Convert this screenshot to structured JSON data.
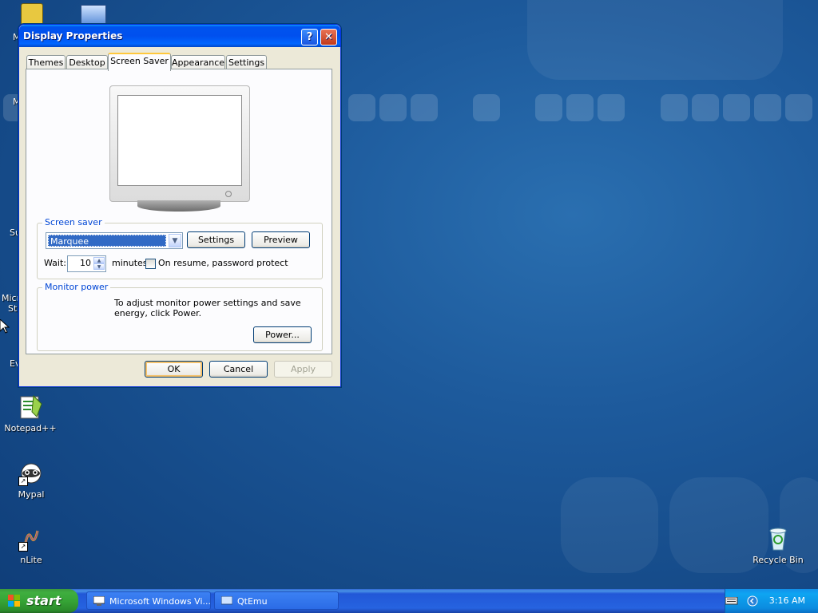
{
  "desktop": {
    "icons": [
      {
        "label": "Notepad++",
        "icon": "notepadpp-icon"
      },
      {
        "label": "Mypal",
        "icon": "mypal-icon"
      },
      {
        "label": "nLite",
        "icon": "nlite-icon"
      },
      {
        "label": "Recycle Bin",
        "icon": "recycle-bin-icon"
      }
    ],
    "partial_labels": [
      "M",
      "M",
      "Su",
      "Micro",
      "Stu",
      "Ev"
    ]
  },
  "dialog": {
    "title": "Display Properties",
    "help_label": "?",
    "close_label": "✕",
    "tabs": [
      {
        "label": "Themes",
        "active": false
      },
      {
        "label": "Desktop",
        "active": false
      },
      {
        "label": "Screen Saver",
        "active": true
      },
      {
        "label": "Appearance",
        "active": false
      },
      {
        "label": "Settings",
        "active": false
      }
    ],
    "screen_saver": {
      "group_label": "Screen saver",
      "selected": "Marquee",
      "settings_label": "Settings",
      "preview_label": "Preview",
      "wait_label": "Wait:",
      "wait_value": "10",
      "minutes_label": "minutes",
      "password_label": "On resume, password protect",
      "password_checked": false
    },
    "monitor_power": {
      "group_label": "Monitor power",
      "description": "To adjust monitor power settings and save energy, click Power.",
      "power_label": "Power..."
    },
    "buttons": {
      "ok": "OK",
      "cancel": "Cancel",
      "apply": "Apply"
    }
  },
  "taskbar": {
    "start_label": "start",
    "items": [
      {
        "label": "Microsoft Windows Vi..."
      },
      {
        "label": "QtEmu"
      }
    ],
    "clock": "3:16 AM"
  }
}
